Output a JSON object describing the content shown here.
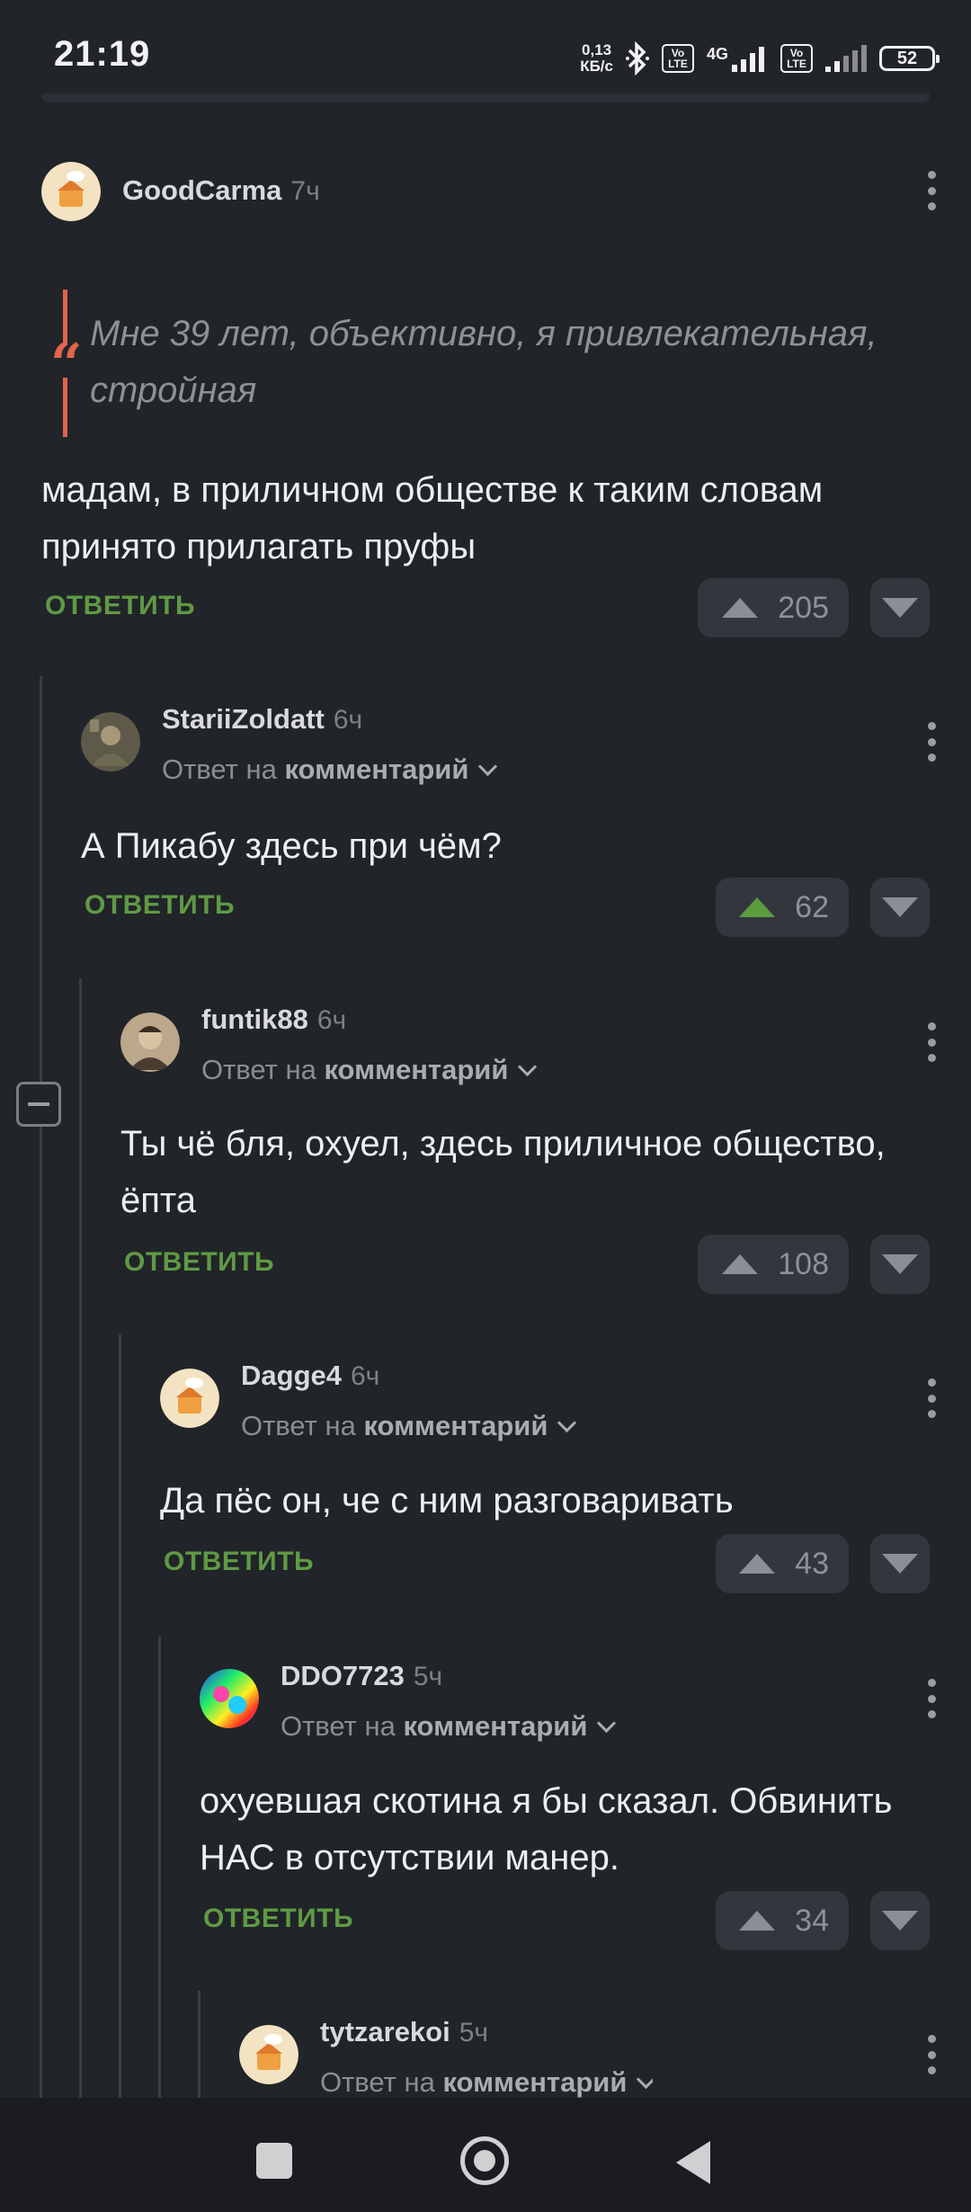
{
  "status": {
    "time": "21:19",
    "net_speed_top": "0,13",
    "net_speed_bottom": "КБ/с",
    "volte1": "Vo LTE",
    "network": "4G",
    "volte2": "Vo LTE",
    "battery": "52"
  },
  "comments": [
    {
      "username": "GoodCarma",
      "time": "7ч",
      "quote": "Мне 39 лет, объективно, я привлекательная, стройная",
      "text": "мадам, в приличном обществе к таким словам принято прилагать пруфы",
      "reply_label": "ОТВЕТИТЬ",
      "votes": "205"
    },
    {
      "username": "StariiZoldatt",
      "time": "6ч",
      "reply_prefix": "Ответ на",
      "reply_target": "комментарий",
      "text": "А Пикабу здесь при чём?",
      "reply_label": "ОТВЕТИТЬ",
      "votes": "62",
      "upvoted": true
    },
    {
      "username": "funtik88",
      "time": "6ч",
      "reply_prefix": "Ответ на",
      "reply_target": "комментарий",
      "text": "Ты чё бля, охуел, здесь приличное общество, ёпта",
      "reply_label": "ОТВЕТИТЬ",
      "votes": "108"
    },
    {
      "username": "Dagge4",
      "time": "6ч",
      "reply_prefix": "Ответ на",
      "reply_target": "комментарий",
      "text": "Да пёс он, че с ним разговаривать",
      "reply_label": "ОТВЕТИТЬ",
      "votes": "43"
    },
    {
      "username": "DDO7723",
      "time": "5ч",
      "reply_prefix": "Ответ на",
      "reply_target": "комментарий",
      "text": "охуевшая скотина я бы сказал. Обвинить НАС в отсутствии манер.",
      "reply_label": "ОТВЕТИТЬ",
      "votes": "34"
    },
    {
      "username": "tytzarekoi",
      "time": "5ч",
      "reply_prefix": "Ответ на",
      "reply_target": "комментарий"
    }
  ],
  "colors": {
    "background": "#212429",
    "accent_green": "#5f9a43",
    "quote_red": "#e1644b"
  }
}
